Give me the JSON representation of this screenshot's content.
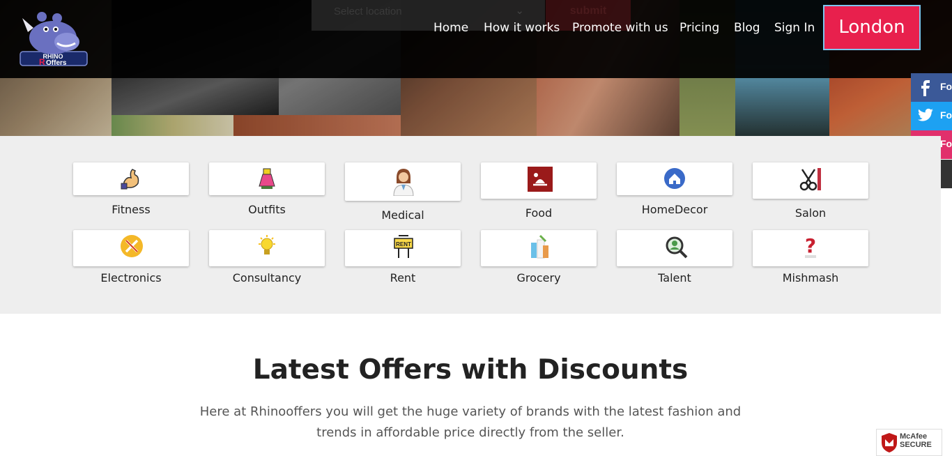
{
  "brand": {
    "logo_text": "RHINO Offers"
  },
  "search": {
    "location_placeholder": "Select location",
    "submit_label": "submit"
  },
  "nav": {
    "items": [
      "Home",
      "How it works",
      "Promote with us",
      "Pricing",
      "Blog",
      "Sign In"
    ],
    "city_button": "London"
  },
  "social": [
    {
      "icon": "facebook-icon",
      "label": "Fo",
      "color": "#3b5998"
    },
    {
      "icon": "twitter-icon",
      "label": "Fo",
      "color": "#1da1f2"
    },
    {
      "icon": "instagram-icon",
      "label": "Fo",
      "color": "#e1306c"
    },
    {
      "icon": "chat-icon",
      "label": "",
      "color": "#333333"
    }
  ],
  "categories": [
    {
      "label": "Fitness",
      "icon": "arm-muscle-icon"
    },
    {
      "label": "Outfits",
      "icon": "dress-icon"
    },
    {
      "label": "Medical",
      "icon": "doctor-icon"
    },
    {
      "label": "Food",
      "icon": "food-serving-icon"
    },
    {
      "label": "HomeDecor",
      "icon": "home-icon"
    },
    {
      "label": "Salon",
      "icon": "scissors-comb-icon"
    },
    {
      "label": "Electronics",
      "icon": "tools-icon"
    },
    {
      "label": "Consultancy",
      "icon": "lightbulb-icon"
    },
    {
      "label": "Rent",
      "icon": "rent-sign-icon"
    },
    {
      "label": "Grocery",
      "icon": "grocery-icon"
    },
    {
      "label": "Talent",
      "icon": "talent-search-icon"
    },
    {
      "label": "Mishmash",
      "icon": "question-icon"
    }
  ],
  "section": {
    "title": "Latest Offers with Discounts",
    "description": "Here at Rhinooffers you will get the huge variety of brands with the latest fashion and trends in affordable price directly from the seller."
  },
  "badge": {
    "line1": "McAfee",
    "line2": "SECURE"
  },
  "colors": {
    "accent": "#e8204d",
    "header_bg": "#000000",
    "categories_bg": "#eeeeee"
  }
}
